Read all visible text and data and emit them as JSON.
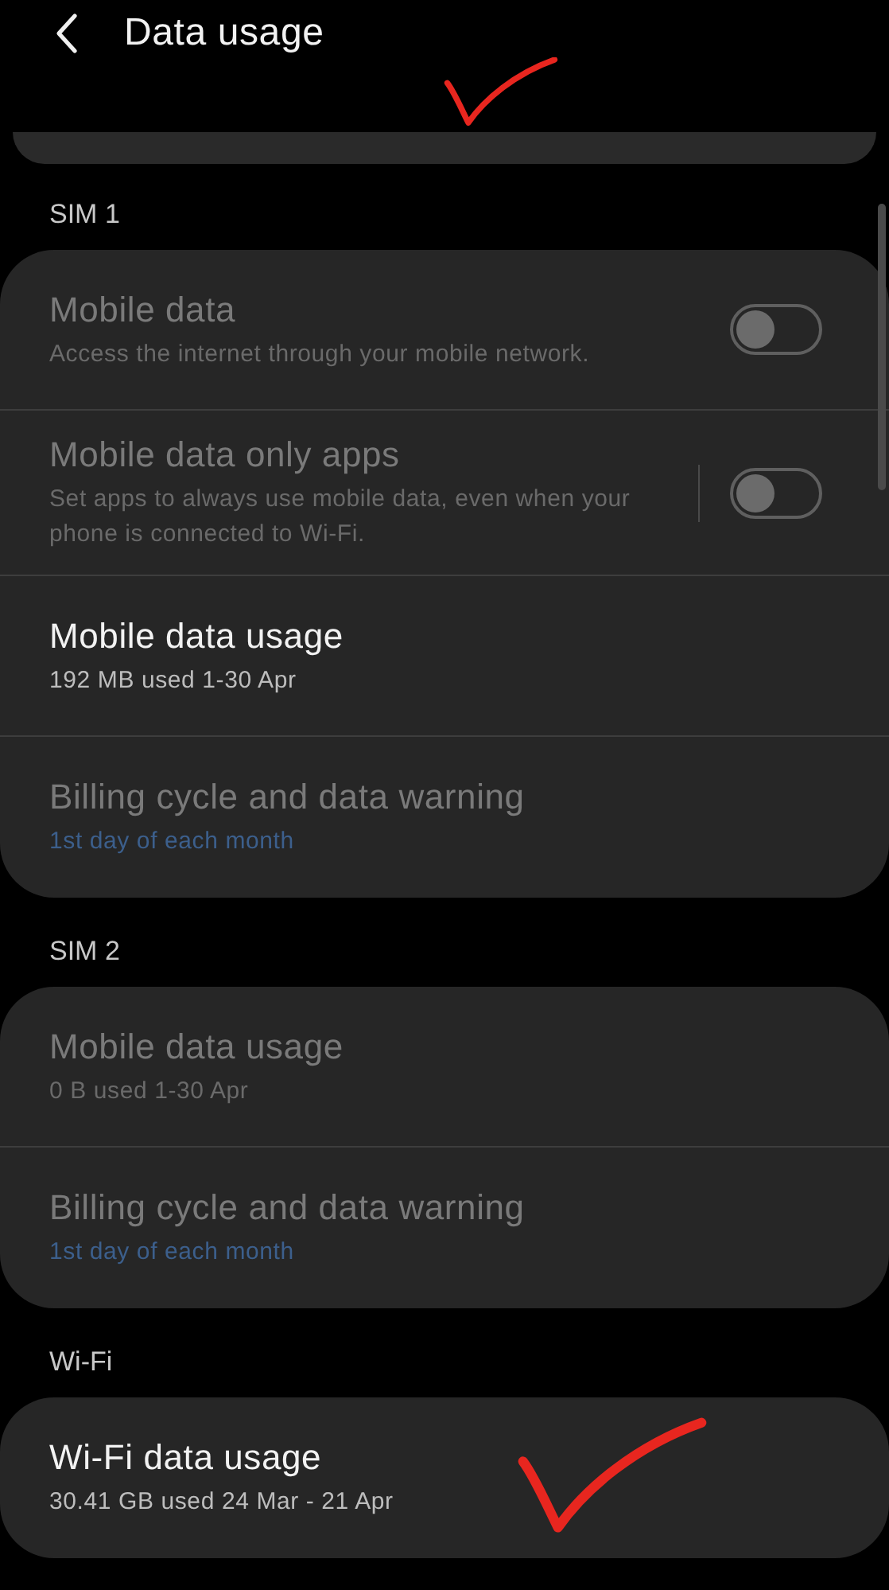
{
  "header": {
    "title": "Data usage"
  },
  "sections": [
    {
      "label": "SIM 1",
      "rows": [
        {
          "kind": "switch",
          "title": "Mobile data",
          "subtitle": "Access the internet through your mobile network.",
          "disabled": true,
          "accent": false,
          "on": false,
          "separator": false
        },
        {
          "kind": "switch",
          "title": "Mobile data only apps",
          "subtitle": "Set apps to always use mobile data, even when your phone is connected to Wi-Fi.",
          "disabled": true,
          "accent": false,
          "on": false,
          "separator": true
        },
        {
          "kind": "plain",
          "title": "Mobile data usage",
          "subtitle": "192 MB used 1-30 Apr",
          "disabled": false,
          "accent": false
        },
        {
          "kind": "plain",
          "title": "Billing cycle and data warning",
          "subtitle": "1st day of each month",
          "disabled": true,
          "accent": true
        }
      ]
    },
    {
      "label": "SIM 2",
      "rows": [
        {
          "kind": "plain",
          "title": "Mobile data usage",
          "subtitle": "0 B used 1-30 Apr",
          "disabled": true,
          "accent": false
        },
        {
          "kind": "plain",
          "title": "Billing cycle and data warning",
          "subtitle": "1st day of each month",
          "disabled": true,
          "accent": true
        }
      ]
    },
    {
      "label": "Wi-Fi",
      "rows": [
        {
          "kind": "plain",
          "title": "Wi-Fi data usage",
          "subtitle": "30.41 GB used 24 Mar - 21 Apr",
          "disabled": false,
          "accent": false
        }
      ]
    }
  ]
}
